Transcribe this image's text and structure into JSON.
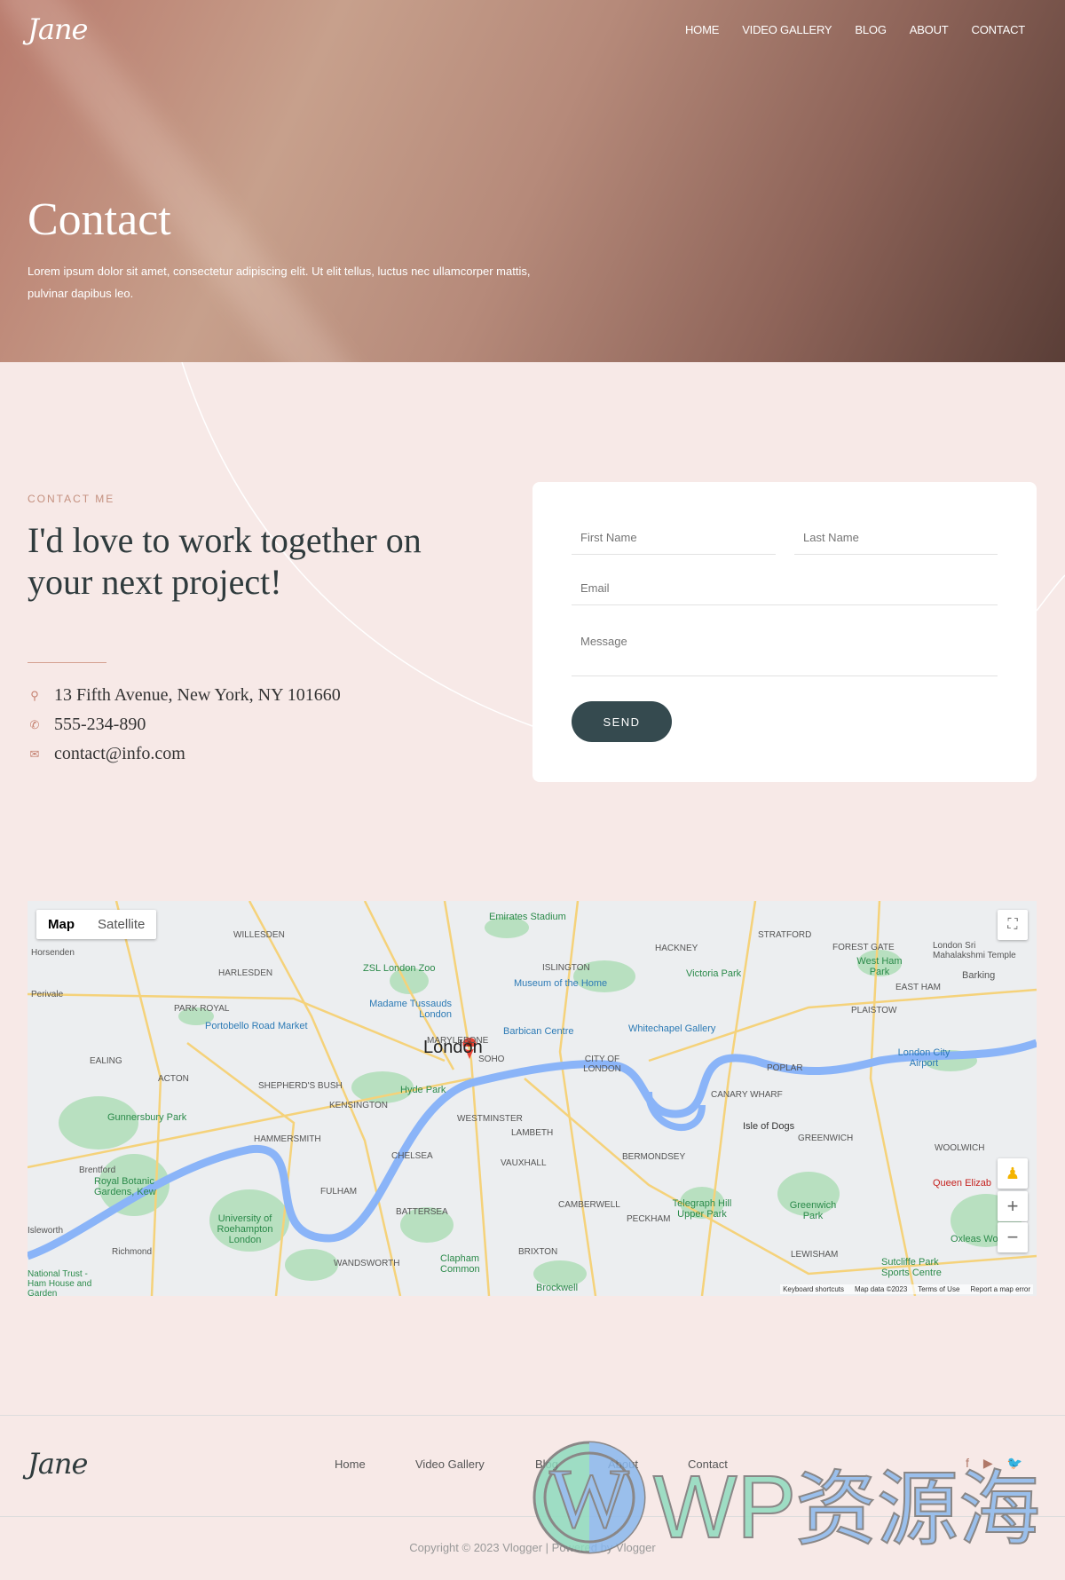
{
  "header": {
    "logo": "Jane",
    "nav": [
      "HOME",
      "VIDEO GALLERY",
      "BLOG",
      "ABOUT",
      "CONTACT"
    ]
  },
  "hero": {
    "title": "Contact",
    "text": "Lorem ipsum dolor sit amet, consectetur adipiscing elit. Ut elit tellus, luctus nec ullamcorper mattis, pulvinar dapibus leo."
  },
  "contact": {
    "eyebrow": "CONTACT ME",
    "heading": "I'd love to work together on your next project!",
    "address": "13 Fifth Avenue, New York, NY 101660",
    "phone": "555-234-890",
    "email": "contact@info.com",
    "icons": [
      "map-pin-icon",
      "phone-icon",
      "envelope-icon"
    ],
    "accent": "#c4907f"
  },
  "form": {
    "first_name": "First Name",
    "last_name": "Last Name",
    "email": "Email",
    "message": "Message",
    "send": "SEND",
    "button_color": "#354a4f"
  },
  "map": {
    "type_map": "Map",
    "type_satellite": "Satellite",
    "center": "London",
    "labels": [
      "Horsenden",
      "Perivale",
      "WILLESDEN",
      "HARLESDEN",
      "PARK ROYAL",
      "EALING",
      "ACTON",
      "SHEPHERD'S BUSH",
      "KENSINGTON",
      "HAMMERSMITH",
      "CHELSEA",
      "FULHAM",
      "Brentford",
      "Gunnersbury Park",
      "Royal Botanic Gardens, Kew",
      "Isleworth",
      "Richmond",
      "BATTERSEA",
      "WANDSWORTH",
      "Clapham Common",
      "BRIXTON",
      "Brockwell",
      "CAMBERWELL",
      "PECKHAM",
      "VAUXHALL",
      "LAMBETH",
      "WESTMINSTER",
      "SOHO",
      "MARYLEBONE",
      "CITY OF LONDON",
      "BERMONDSEY",
      "ISLINGTON",
      "HACKNEY",
      "STRATFORD",
      "FOREST GATE",
      "EAST HAM",
      "Barking",
      "PLAISTOW",
      "POPLAR",
      "CANARY WHARF",
      "Isle of Dogs",
      "GREENWICH",
      "WOOLWICH",
      "LEWISHAM",
      "Emirates Stadium",
      "ZSL London Zoo",
      "Museum of the Home",
      "Victoria Park",
      "Madame Tussauds London",
      "Portobello Road Market",
      "Barbican Centre",
      "Whitechapel Gallery",
      "Hyde Park",
      "London City Airport",
      "Telegraph Hill Upper Park",
      "Greenwich Park",
      "Sutcliffe Park Sports Centre",
      "Oxleas Wood",
      "Queen Elizab",
      "London Sri Mahalakshmi Temple",
      "West Ham Park",
      "University of Roehampton London",
      "National Trust - Ham House and Garden"
    ],
    "attribution": [
      "Keyboard shortcuts",
      "Map data ©2023",
      "Terms of Use",
      "Report a map error"
    ],
    "controls": [
      "fullscreen-icon",
      "pegman-icon",
      "zoom-in-icon",
      "zoom-out-icon"
    ]
  },
  "footer": {
    "logo": "Jane",
    "links": [
      "Home",
      "Video Gallery",
      "Blog",
      "About",
      "Contact"
    ],
    "social": [
      "facebook-icon",
      "youtube-icon",
      "twitter-icon"
    ],
    "copyright": "Copyright © 2023 Vlogger | Powered by Vlogger"
  },
  "watermark": "WP资源海"
}
